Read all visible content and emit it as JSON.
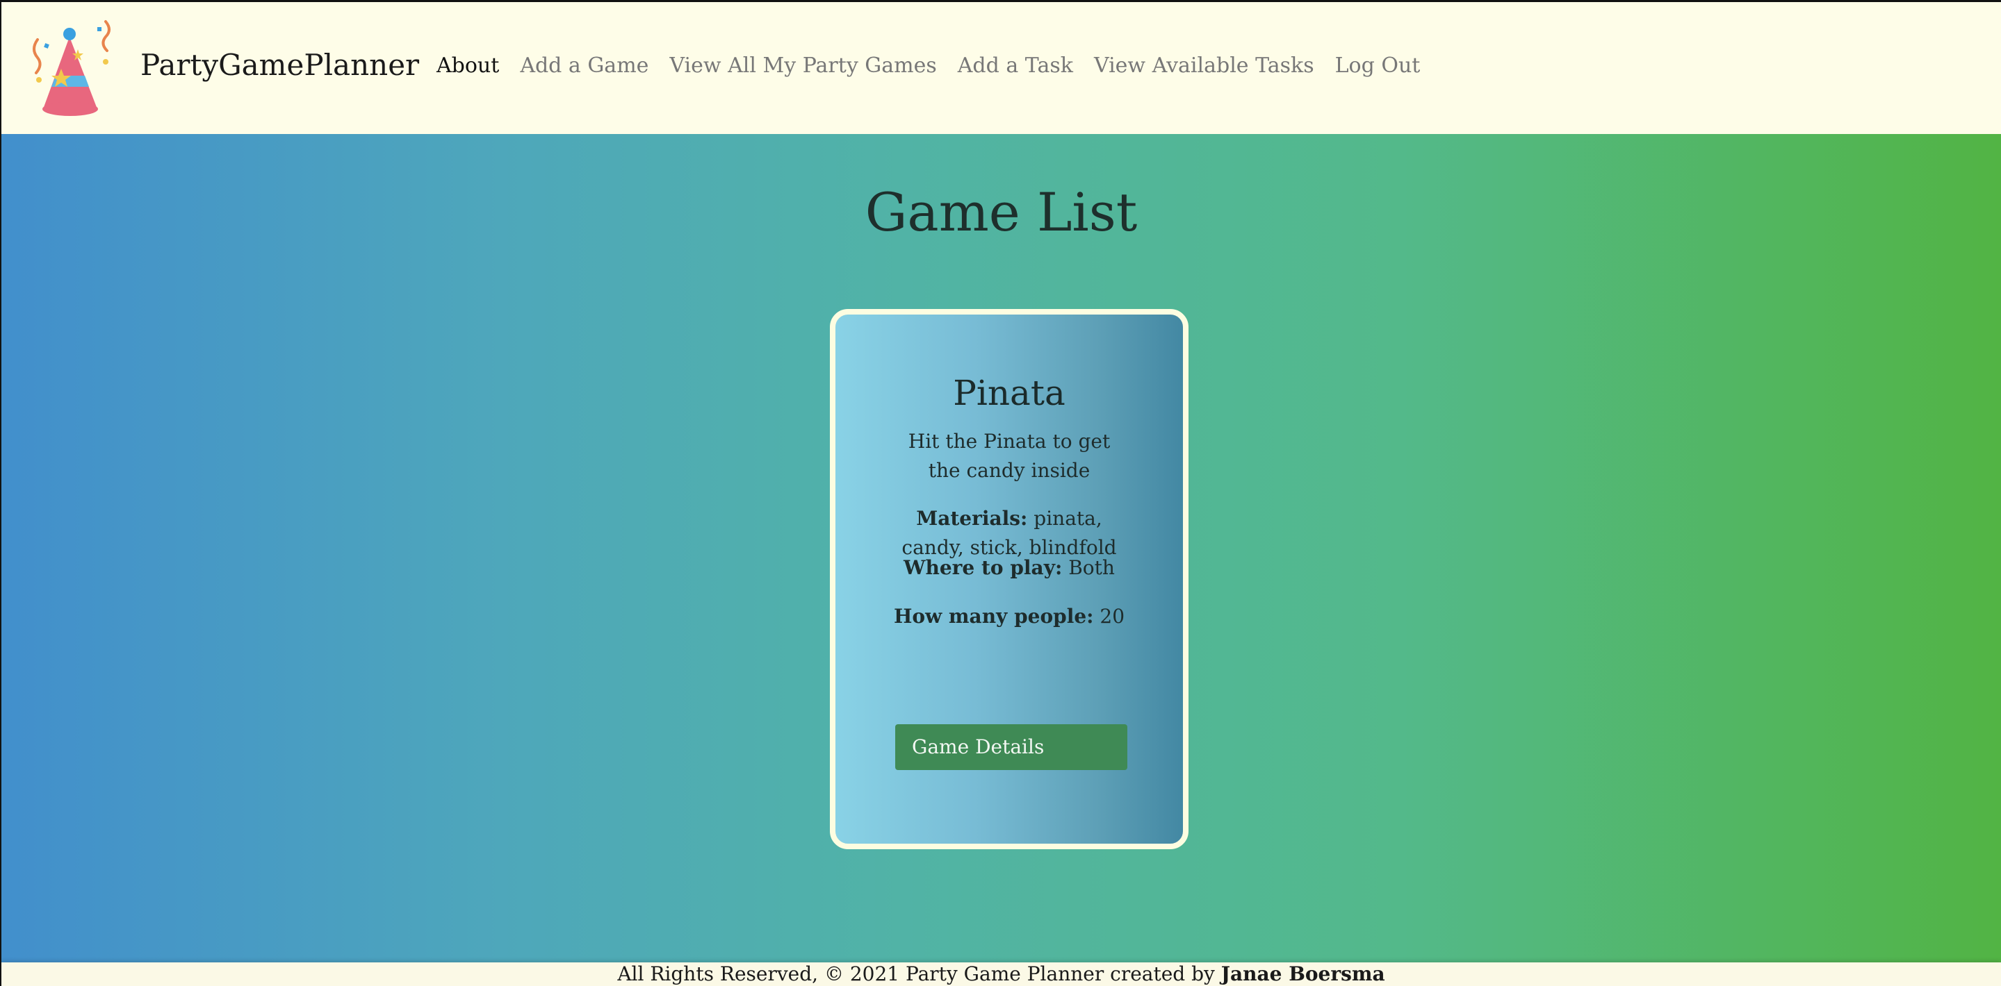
{
  "brand": {
    "name": "PartyGamePlanner",
    "logo_icon": "party-hat-icon"
  },
  "nav": {
    "items": [
      {
        "label": "About",
        "active": true
      },
      {
        "label": "Add a Game",
        "active": false
      },
      {
        "label": "View All My Party Games",
        "active": false
      },
      {
        "label": "Add a Task",
        "active": false
      },
      {
        "label": "View Available Tasks",
        "active": false
      },
      {
        "label": "Log Out",
        "active": false
      }
    ]
  },
  "main": {
    "title": "Game List",
    "card": {
      "title": "Pinata",
      "description": "Hit the Pinata to get the candy inside",
      "materials_label": "Materials:",
      "materials_value": "pinata, candy, stick, blindfold",
      "where_label": "Where to play:",
      "where_value": "Both",
      "people_label": "How many people:",
      "people_value": "20",
      "button_label": "Game Details"
    }
  },
  "footer": {
    "text": "All Rights Reserved, © 2021 Party Game Planner created by",
    "author": "Janae Boersma"
  },
  "colors": {
    "navbar_bg": "#fefde8",
    "button_bg": "#3f8a55",
    "card_border": "#fdfde1",
    "gradient_start": "#428fcc",
    "gradient_end": "#52b444"
  }
}
